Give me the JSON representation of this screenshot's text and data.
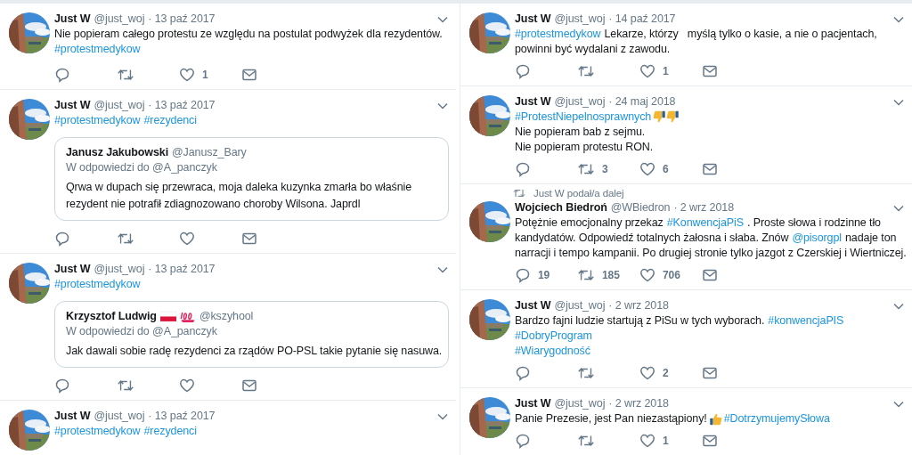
{
  "columns": [
    {
      "tweets": [
        {
          "name": "Just W",
          "handle": "@just_woj",
          "date": "· 13 paź 2017",
          "body": [
            [
              {
                "kind": "text",
                "text": "Nie popieram całego protestu ze względu na postulat podwyżek dla rezydentów."
              }
            ],
            [
              {
                "kind": "link",
                "text": "#protestmedykow"
              }
            ]
          ],
          "actions": [
            {
              "kind": "reply"
            },
            {
              "kind": "retweet"
            },
            {
              "kind": "like",
              "count": "1"
            },
            {
              "kind": "message"
            }
          ]
        },
        {
          "name": "Just W",
          "handle": "@just_woj",
          "date": "· 13 paź 2017",
          "body": [
            [
              {
                "kind": "link",
                "text": "#protestmedykow"
              },
              {
                "kind": "link",
                "text": "#rezydenci"
              }
            ]
          ],
          "quote": {
            "name": "Janusz Jakubowski",
            "handle": "@Janusz_Bary",
            "reply_to": "W odpowiedzi do @A_panczyk",
            "text": [
              "Qrwa w dupach się przewraca,  moja daleka kuzynka zmarła bo właśnie",
              "rezydent nie potrafił zdiagnozowano choroby Wilsona. Japrdl"
            ]
          },
          "actions": [
            {
              "kind": "reply"
            },
            {
              "kind": "retweet"
            },
            {
              "kind": "like"
            },
            {
              "kind": "message"
            }
          ]
        },
        {
          "name": "Just W",
          "handle": "@just_woj",
          "date": "· 13 paź 2017",
          "body": [
            [
              {
                "kind": "link",
                "text": "#protestmedykow"
              }
            ]
          ],
          "quote": {
            "name": "Krzysztof Ludwig",
            "badges": [
              {
                "kind": "flag"
              },
              {
                "kind": "hundred"
              }
            ],
            "handle": "@kszyhool",
            "reply_to": "W odpowiedzi do @A_panczyk",
            "text": [
              "Jak dawali sobie radę rezydenci za rządów PO-PSL takie pytanie się nasuwa."
            ]
          },
          "actions": [
            {
              "kind": "reply"
            },
            {
              "kind": "retweet"
            },
            {
              "kind": "like"
            },
            {
              "kind": "message"
            }
          ]
        },
        {
          "name": "Just W",
          "handle": "@just_woj",
          "date": "· 13 paź 2017",
          "body": [
            [
              {
                "kind": "link",
                "text": "#protestmedykow"
              },
              {
                "kind": "link",
                "text": "#rezydenci"
              }
            ]
          ]
        }
      ]
    },
    {
      "tweets": [
        {
          "name": "Just W",
          "handle": "@just_woj",
          "date": "· 14 paź 2017",
          "body": [
            [
              {
                "kind": "link",
                "text": "#protestmedykow"
              },
              {
                "kind": "text",
                "text": "Lekarze, którzy   myślą tylko o kasie, a nie o pacjentach,"
              }
            ],
            [
              {
                "kind": "text",
                "text": "powinni być wydalani z zawodu."
              }
            ]
          ],
          "actions": [
            {
              "kind": "reply"
            },
            {
              "kind": "retweet"
            },
            {
              "kind": "like",
              "count": "1"
            },
            {
              "kind": "message"
            }
          ]
        },
        {
          "name": "Just W",
          "handle": "@just_woj",
          "date": "· 24 maj 2018",
          "body": [
            [
              {
                "kind": "link",
                "text": "#ProtestNiepelnosprawnych"
              },
              {
                "kind": "thumbs_down"
              },
              {
                "kind": "thumbs_down"
              }
            ],
            [
              {
                "kind": "text",
                "text": "Nie popieram bab z sejmu."
              }
            ],
            [
              {
                "kind": "text",
                "text": "Nie popieram protestu RON."
              }
            ]
          ],
          "actions": [
            {
              "kind": "reply"
            },
            {
              "kind": "retweet",
              "count": "3"
            },
            {
              "kind": "like",
              "count": "6"
            },
            {
              "kind": "message"
            }
          ]
        },
        {
          "retweeted_by": "Just W podał/a dalej",
          "name": "Wojciech Biedroń",
          "handle": "@WBiedron",
          "date": "· 2 wrz 2018",
          "body": [
            [
              {
                "kind": "text",
                "text": "Potężnie emocjonalny przekaz"
              },
              {
                "kind": "link",
                "text": "#KonwencjaPiS"
              },
              {
                "kind": "text",
                "text": ". Proste słowa i rodzinne tło"
              }
            ],
            [
              {
                "kind": "text",
                "text": "kandydatów. Odpowiedź totalnych żałosna i słaba. Znów"
              },
              {
                "kind": "link",
                "text": "@pisorgpl"
              },
              {
                "kind": "text",
                "text": "nadaje ton"
              }
            ],
            [
              {
                "kind": "text",
                "text": "narracji i tempo kampanii. Po drugiej stronie tylko jazgot z Czerskiej i Wiertniczej."
              }
            ]
          ],
          "actions": [
            {
              "kind": "reply",
              "count": "19"
            },
            {
              "kind": "retweet",
              "count": "185"
            },
            {
              "kind": "like",
              "count": "706"
            },
            {
              "kind": "message"
            }
          ]
        },
        {
          "name": "Just W",
          "handle": "@just_woj",
          "date": "· 2 wrz 2018",
          "body": [
            [
              {
                "kind": "text",
                "text": "Bardzo fajni ludzie startują z PiSu w tych wyborach."
              },
              {
                "kind": "link",
                "text": "#konwencjaPIS"
              }
            ],
            [
              {
                "kind": "link",
                "text": "#DobryProgram"
              }
            ],
            [
              {
                "kind": "link",
                "text": "#Wiarygodność"
              }
            ]
          ],
          "actions": [
            {
              "kind": "reply"
            },
            {
              "kind": "retweet"
            },
            {
              "kind": "like",
              "count": "2"
            },
            {
              "kind": "message"
            }
          ]
        },
        {
          "name": "Just W",
          "handle": "@just_woj",
          "date": "· 2 wrz 2018",
          "body": [
            [
              {
                "kind": "text",
                "text": "Panie Prezesie, jest Pan niezastąpiony!"
              },
              {
                "kind": "thumbs_up"
              },
              {
                "kind": "link",
                "text": "#DotrzymujemySłowa"
              }
            ]
          ],
          "actions": [
            {
              "kind": "reply"
            },
            {
              "kind": "retweet"
            },
            {
              "kind": "like",
              "count": "1"
            },
            {
              "kind": "message"
            }
          ]
        }
      ]
    }
  ]
}
